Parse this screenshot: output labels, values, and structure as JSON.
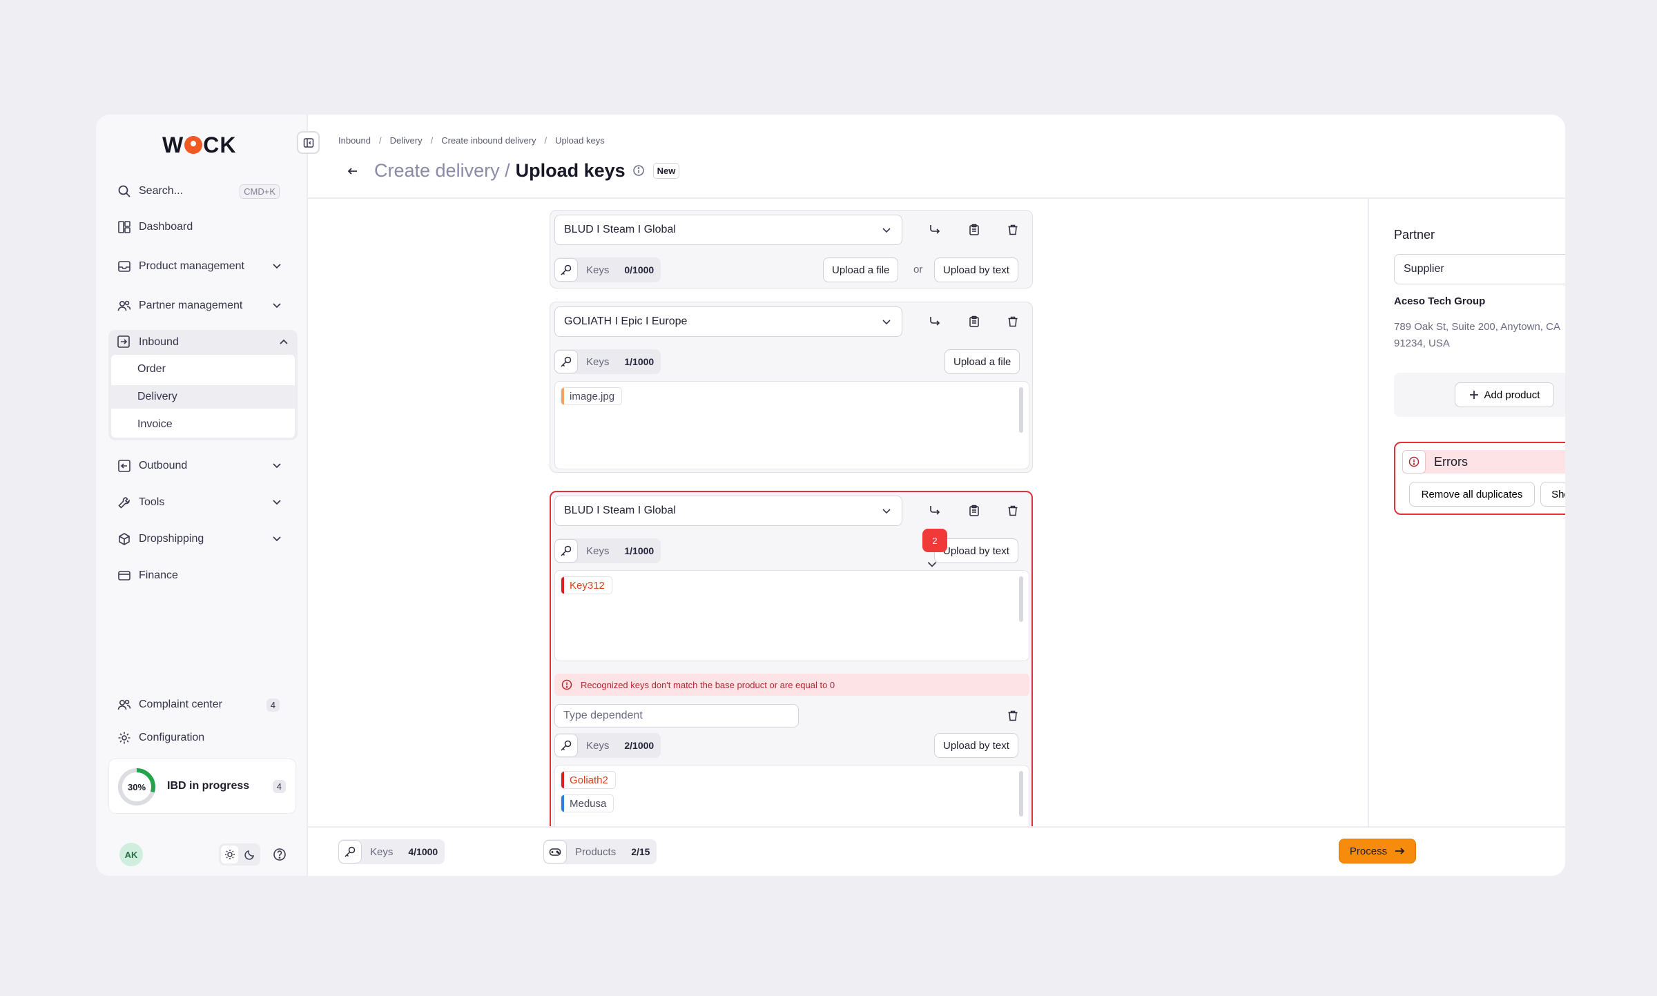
{
  "brand": {
    "logo_left": "W",
    "logo_right": "CK"
  },
  "sidebar": {
    "search": {
      "label": "Search...",
      "shortcut": "CMD+K"
    },
    "items": [
      {
        "label": "Dashboard",
        "icon": "dashboard-icon"
      },
      {
        "label": "Product management",
        "icon": "inbox-icon"
      },
      {
        "label": "Partner management",
        "icon": "users-icon"
      },
      {
        "label": "Inbound",
        "icon": "inbound-icon"
      },
      {
        "label": "Outbound",
        "icon": "outbound-icon"
      },
      {
        "label": "Tools",
        "icon": "wrench-icon"
      },
      {
        "label": "Dropshipping",
        "icon": "box-icon"
      },
      {
        "label": "Finance",
        "icon": "card-icon"
      },
      {
        "label": "Complaint center",
        "icon": "users-icon",
        "count": "4"
      },
      {
        "label": "Configuration",
        "icon": "gear-icon"
      }
    ],
    "inbound_sub": [
      {
        "label": "Order"
      },
      {
        "label": "Delivery"
      },
      {
        "label": "Invoice"
      }
    ],
    "ibd": {
      "percent_label": "30%",
      "progress": 0.3,
      "label": "IBD in progress",
      "count": "4"
    },
    "avatar": "AK"
  },
  "header": {
    "breadcrumb": [
      "Inbound",
      "Delivery",
      "Create inbound delivery",
      "Upload keys"
    ],
    "title_muted": "Create delivery /",
    "title": "Upload keys",
    "badge": "New"
  },
  "cards": [
    {
      "product": "BLUD I Steam I Global",
      "keys_label": "Keys",
      "keys_count": "0/1000",
      "upload_file": "Upload a file",
      "or": "or",
      "upload_text": "Upload by text"
    },
    {
      "product": "GOLIATH I Epic I Europe",
      "keys_label": "Keys",
      "keys_count": "1/1000",
      "upload_file": "Upload a file",
      "file": "image.jpg"
    },
    {
      "product": "BLUD I Steam I Global",
      "keys_label": "Keys",
      "keys_count": "1/1000",
      "upload_text": "Upload by text",
      "key_tag": "Key312",
      "error_msg": "Recognized keys don't match the base product or are equal to 0",
      "dependent_placeholder": "Type dependent",
      "dep_keys_label": "Keys",
      "dep_keys_count": "2/1000",
      "dep_upload_text": "Upload by text",
      "dep_tags": [
        "Goliath2",
        "Medusa"
      ],
      "error_count": "2"
    }
  ],
  "footer": {
    "keys_label": "Keys",
    "keys_count": "4/1000",
    "products_label": "Products",
    "products_count": "2/15",
    "process": "Process"
  },
  "right_panel": {
    "title": "Partner",
    "partner_type": "Supplier",
    "company": "Aceso Tech Group",
    "address": "789 Oak St, Suite 200, Anytown, CA 91234, USA",
    "add_product": "Add product",
    "errors_title": "Errors",
    "remove_duplicates": "Remove all duplicates",
    "show_more": "Show more"
  },
  "colors": {
    "accent": "#f78c0c",
    "error": "#e0303a",
    "logo_o": "#f15a24"
  }
}
